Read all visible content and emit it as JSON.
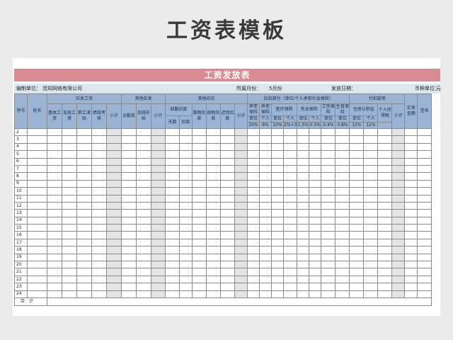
{
  "doc_title": "工资表模板",
  "sheet": {
    "title": "工资发放表",
    "unit_label": "编制单位：",
    "unit_value": "觅知网络有限公司",
    "month_label": "所属月份：",
    "month_value": "5月份",
    "date_label": "发放日期：",
    "currency_label": "币种单位：",
    "currency_value": "元"
  },
  "header": {
    "seq": "序号",
    "name": "姓名",
    "payable": "应发工资",
    "base": "基本工资",
    "overtime": "加班工资",
    "allowance": "职工津贴",
    "performance": "绩效考核",
    "subtotal1": "小计",
    "other_payable": "其他应发",
    "attendance_bonus": "全勤奖",
    "overtime_subsidy": "加班补贴",
    "subtotal2": "小计",
    "other_deduct": "其他应扣",
    "absence_deduct": "缺勤扣款",
    "days": "天数",
    "deduct": "扣款",
    "personal_leave": "事假扣款",
    "sick_leave": "病假扣款",
    "late": "迟到扣款",
    "subtotal3": "小计",
    "social": "应扣部分（单位/个人承担社会保险）",
    "pension": "养老保险",
    "pension2": "养老保险",
    "medical": "医疗保险",
    "unemployment": "失业保险",
    "injury": "工伤保险",
    "maternity": "生育保险",
    "withhold": "代扣款项",
    "housing": "住房公积金",
    "income_tax": "个人所得税",
    "subtotal4": "小计",
    "net": "实发金额",
    "sign": "签名",
    "r_unit": "单位",
    "r_person": "个人",
    "v_pension_unit": "20%",
    "v_pension_person": "8%",
    "v_medical_unit": "10%",
    "v_medical_person": "2%+3",
    "v_unemp_unit": "1.5%",
    "v_unemp_person": "0.5%",
    "v_injury": "0.4%",
    "v_maternity": "0.8%",
    "v_housing_unit": "12%",
    "v_housing_person": "12%"
  },
  "rows": [
    "2",
    "3",
    "4",
    "5",
    "6",
    "7",
    "8",
    "9",
    "10",
    "11",
    "12",
    "13",
    "14",
    "15",
    "16",
    "17",
    "18",
    "19",
    "20",
    "21",
    "22",
    "23",
    "24"
  ],
  "total_label": "合计"
}
